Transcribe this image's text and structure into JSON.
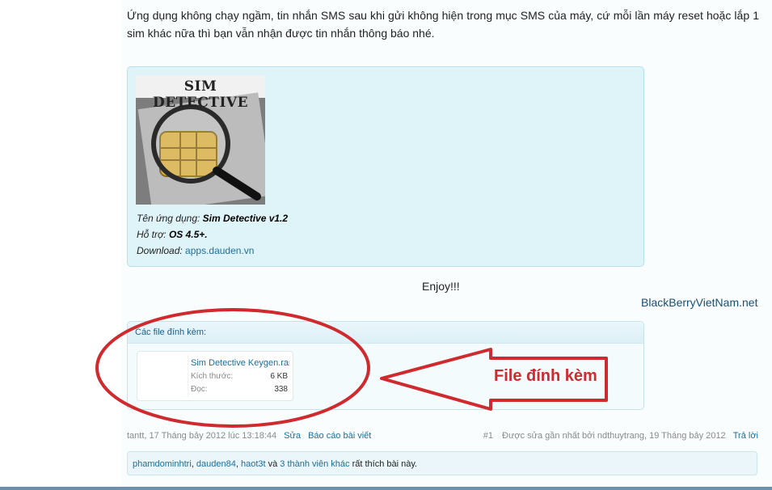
{
  "intro": "Ứng dụng không chạy ngầm, tin nhắn SMS sau khi gửi không hiện trong mục SMS của máy, cứ mỗi lần máy reset hoặc lắp 1 sim khác nữa thì bạn vẫn nhận được tin nhắn thông báo nhé.",
  "app_card": {
    "image_caption": "SIM DETECTIVE",
    "name_label": "Tên ứng dụng: ",
    "name_value": "Sim Detective v1.2",
    "support_label": "Hỗ trợ: ",
    "support_value": "OS 4.5+.",
    "download_label": "Download: ",
    "download_link": "apps.dauden.vn"
  },
  "enjoy": "Enjoy!!!",
  "brand": "BlackBerryVietNam.net",
  "attachments": {
    "title": "Các file đính kèm:",
    "files": [
      {
        "name": "Sim Detective Keygen.rar",
        "size_label": "Kích thước:",
        "size_value": "6 KB",
        "views_label": "Đọc:",
        "views_value": "338"
      }
    ]
  },
  "annotation_label": "File đính kèm",
  "annotation_color": "#cf2a2e",
  "post": {
    "author_date": "tantt, 17 Tháng bảy 2012 lúc 13:18:44",
    "edit": "Sửa",
    "report": "Báo cáo bài viết",
    "number": "#1",
    "edited_note": "Được sửa gần nhất bởi ndthuytrang, 19 Tháng bảy 2012",
    "reply": "Trả lời"
  },
  "likes": {
    "user1": "phamdominhtri",
    "sep1": ", ",
    "user2": "dauden84",
    "sep2": ", ",
    "user3": "haot3t",
    "and": " và ",
    "others": "3 thành viên khác",
    "suffix": " rất thích bài này."
  }
}
